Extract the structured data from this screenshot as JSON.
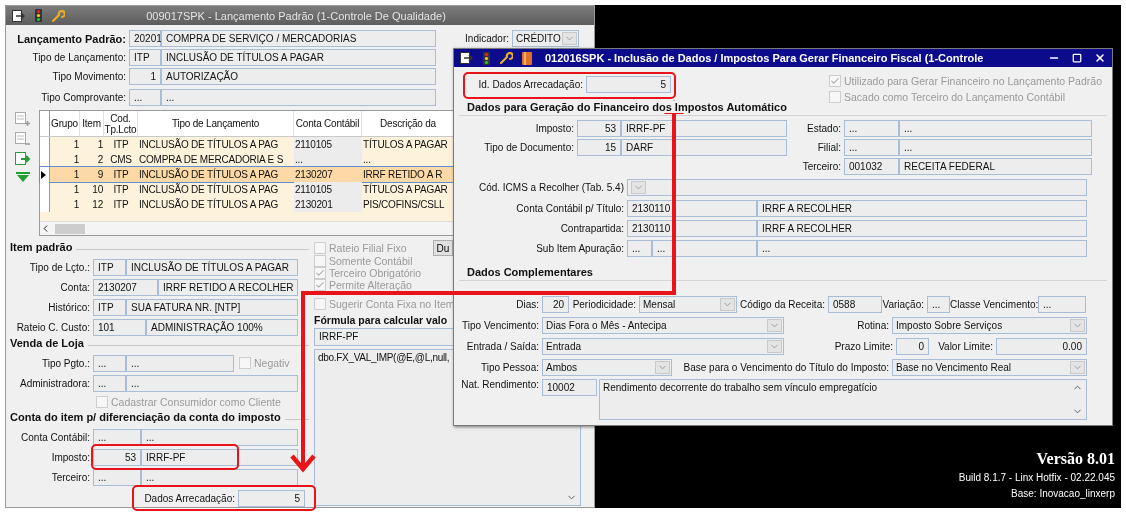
{
  "main_window": {
    "title": "009017SPK - Lançamento Padrão (1-Controle De Qualidade)",
    "header_fields": [
      {
        "label": "Lançamento Padrão:",
        "parts": [
          "20201",
          "COMPRA DE SERVIÇO / MERCADORIAS"
        ]
      },
      {
        "label": "Tipo de Lançamento:",
        "parts": [
          "ITP",
          "INCLUSÃO DE TÍTULOS A PAGAR"
        ]
      },
      {
        "label": "Tipo Movimento:",
        "parts": [
          "1",
          "AUTORIZAÇÃO"
        ],
        "right_aligned": true
      },
      {
        "label": "Tipo Comprovante:",
        "parts": [
          "...",
          "..."
        ]
      }
    ],
    "indicator": {
      "label": "Indicador:",
      "value": "CRÉDITO"
    },
    "grid": {
      "columns": [
        "Grupo",
        "Item",
        "Cod. Tp.Lcto",
        "Tipo de Lançamento",
        "Conta Contábil",
        "Descrição da"
      ],
      "rows": [
        {
          "cells": [
            "1",
            "1",
            "ITP",
            "INCLUSÃO DE TÍTULOS A PAG",
            "2110105",
            "TÍTULOS A PAGAR"
          ],
          "selected": false
        },
        {
          "cells": [
            "1",
            "2",
            "CMS",
            "COMPRA DE MERCADORIA E S",
            "...",
            "..."
          ],
          "selected": false
        },
        {
          "cells": [
            "1",
            "9",
            "ITP",
            "INCLUSÃO DE TÍTULOS A PAG",
            "2130207",
            "IRRF RETIDO A R"
          ],
          "selected": true
        },
        {
          "cells": [
            "1",
            "10",
            "ITP",
            "INCLUSÃO DE TÍTULOS A PAG",
            "2110105",
            "TÍTULOS A PAGAR"
          ],
          "selected": false
        },
        {
          "cells": [
            "1",
            "12",
            "ITP",
            "INCLUSÃO DE TÍTULOS A PAG",
            "2130201",
            "PIS/COFINS/CSLL"
          ],
          "selected": false
        }
      ]
    },
    "item_padrao": {
      "title": "Item padrão",
      "fields": [
        {
          "label": "Tipo de Lçto.:",
          "parts": [
            "ITP",
            "INCLUSÃO DE TÍTULOS A PAGAR"
          ]
        },
        {
          "label": "Conta:",
          "parts": [
            "2130207",
            "IRRF RETIDO A RECOLHER"
          ]
        },
        {
          "label": "Histórico:",
          "parts": [
            "ITP",
            "SUA FATURA NR. [NTP]"
          ]
        },
        {
          "label": "Rateio C. Custo:",
          "parts": [
            "101",
            "ADMINISTRAÇÃO 100%"
          ]
        }
      ]
    },
    "venda_de_loja": {
      "title": "Venda de Loja",
      "fields": [
        {
          "label": "Tipo Pgto.:",
          "parts": [
            "...",
            "..."
          ]
        },
        {
          "label": "Administradora:",
          "parts": [
            "...",
            "..."
          ]
        }
      ],
      "negative_option": {
        "label": "Negativ",
        "checked": false,
        "disabled": true
      },
      "consumer_option": {
        "label": "Cadastrar Consumidor como Cliente",
        "checked": false,
        "disabled": true
      }
    },
    "conta_do_item": {
      "title": "Conta do item p/ diferenciação da conta do imposto",
      "fields": [
        {
          "label": "Conta Contábil:",
          "parts": [
            "...",
            "..."
          ]
        },
        {
          "label": "Imposto:",
          "parts": [
            "53",
            "IRRF-PF"
          ],
          "right_aligned": true
        },
        {
          "label": "Terceiro:",
          "parts": [
            "...",
            "..."
          ]
        }
      ],
      "dados_arrecadacao": {
        "label": "Dados Arrecadação:",
        "value": "5"
      }
    },
    "options": [
      {
        "label": "Rateio Filial Fixo",
        "checked": false,
        "disabled": true
      },
      {
        "label": "Somente Contábil",
        "checked": false,
        "disabled": true
      },
      {
        "label": "Terceiro Obrigatório",
        "checked": true,
        "disabled": true
      },
      {
        "label": "Permite Alteração",
        "checked": true,
        "disabled": true
      },
      {
        "label": "Sugerir Conta Fixa no Item",
        "checked": false,
        "disabled": true
      }
    ],
    "side_button": "Du",
    "formula": {
      "title": "Fórmula para calcular valo",
      "name": "IRRF-PF",
      "expression": "dbo.FX_VAL_IMP(@E,@L,null,"
    }
  },
  "dialog": {
    "title": "012016SPK - Inclusão de Dados / Impostos  Para Gerar Financeiro Fiscal (1-Controle",
    "id_field": {
      "label": "Id. Dados Arrecadação:",
      "value": "5"
    },
    "options": [
      {
        "label": "Utilizado para Gerar Financeiro no Lançamento Padrão",
        "checked": true,
        "disabled": true
      },
      {
        "label": "Sacado como Terceiro do Lançamento Contábil",
        "checked": false,
        "disabled": true
      }
    ],
    "section_1_title": "Dados para Geração do Financeiro dos Impostos Automático",
    "left_lookups": [
      {
        "label": "Imposto:",
        "parts": [
          "53",
          "IRRF-PF"
        ],
        "right_aligned": true
      },
      {
        "label": "Tipo de Documento:",
        "parts": [
          "15",
          "DARF"
        ],
        "right_aligned": true
      }
    ],
    "right_lookups": [
      {
        "label": "Estado:",
        "parts": [
          "...",
          "..."
        ]
      },
      {
        "label": "Filial:",
        "parts": [
          "...",
          "..."
        ]
      },
      {
        "label": "Terceiro:",
        "parts": [
          "001032",
          "RECEITA FEDERAL"
        ]
      }
    ],
    "icms": {
      "label": "Cód. ICMS a Recolher (Tab. 5.4)"
    },
    "account_lookups": [
      {
        "label": "Conta Contábil p/ Título:",
        "parts": [
          "2130110",
          "IRRF A RECOLHER"
        ]
      },
      {
        "label": "Contrapartida:",
        "parts": [
          "2130110",
          "IRRF A RECOLHER"
        ]
      },
      {
        "label": "Sub Item Apuração:",
        "parts": [
          "...",
          "...",
          "..."
        ]
      }
    ],
    "section_2_title": "Dados Complementares",
    "complement_rows": [
      [
        {
          "kind": "field",
          "label": "Dias:",
          "value": "20",
          "right_aligned": true
        },
        {
          "kind": "combo",
          "label": "Periodicidade:",
          "value": "Mensal"
        },
        {
          "kind": "field",
          "label": "Código da Receita:",
          "value": "0588"
        },
        {
          "kind": "field",
          "label": "Variação:",
          "value": "..."
        },
        {
          "kind": "field",
          "label": "Classe Vencimento:",
          "value": "..."
        }
      ],
      [
        {
          "kind": "combo",
          "label": "Tipo Vencimento:",
          "value": "Dias Fora o Mês - Antecipa"
        },
        {
          "kind": "combo",
          "label": "Rotina:",
          "value": "Imposto Sobre Serviços"
        }
      ],
      [
        {
          "kind": "combo",
          "label": "Entrada / Saída:",
          "value": "Entrada"
        },
        {
          "kind": "field",
          "label": "Prazo Limite:",
          "value": "0",
          "right_aligned": true
        },
        {
          "kind": "field",
          "label": "Valor Limite:",
          "value": "0.00",
          "right_aligned": true
        }
      ],
      [
        {
          "kind": "combo",
          "label": "Tipo Pessoa:",
          "value": "Ambos"
        },
        {
          "kind": "combo",
          "label": "Base para o Vencimento do Título do Imposto:",
          "value": "Base no Vencimento Real"
        }
      ],
      [
        {
          "kind": "field",
          "label": "Nat. Rendimento:",
          "value": "10002"
        },
        {
          "kind": "memo",
          "value": "Rendimento decorrente do trabalho sem vínculo empregatício"
        }
      ]
    ]
  },
  "version": {
    "title": "Versão 8.01",
    "build": "Build 8.1.7 - Linx Hotfix - 02.22.045",
    "base": "Base: Inovacao_linxerp"
  }
}
